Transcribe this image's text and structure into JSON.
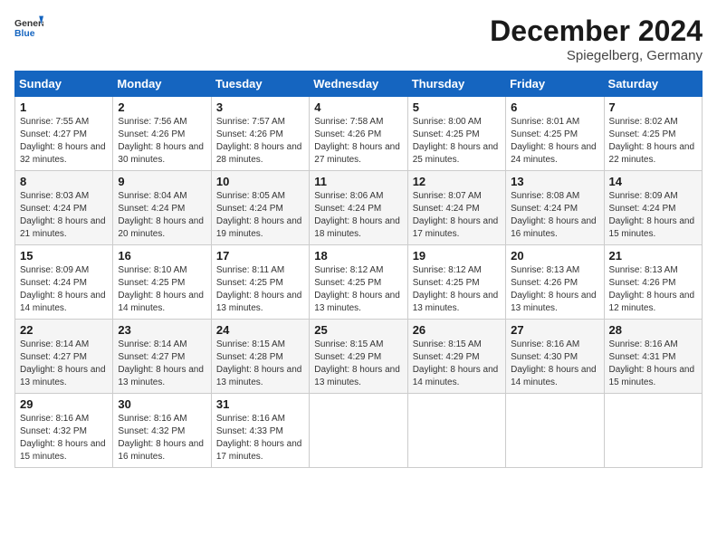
{
  "header": {
    "logo_line1": "General",
    "logo_line2": "Blue",
    "month": "December 2024",
    "location": "Spiegelberg, Germany"
  },
  "days_of_week": [
    "Sunday",
    "Monday",
    "Tuesday",
    "Wednesday",
    "Thursday",
    "Friday",
    "Saturday"
  ],
  "weeks": [
    [
      {
        "day": 1,
        "sunrise": "7:55 AM",
        "sunset": "4:27 PM",
        "daylight": "8 hours and 32 minutes."
      },
      {
        "day": 2,
        "sunrise": "7:56 AM",
        "sunset": "4:26 PM",
        "daylight": "8 hours and 30 minutes."
      },
      {
        "day": 3,
        "sunrise": "7:57 AM",
        "sunset": "4:26 PM",
        "daylight": "8 hours and 28 minutes."
      },
      {
        "day": 4,
        "sunrise": "7:58 AM",
        "sunset": "4:26 PM",
        "daylight": "8 hours and 27 minutes."
      },
      {
        "day": 5,
        "sunrise": "8:00 AM",
        "sunset": "4:25 PM",
        "daylight": "8 hours and 25 minutes."
      },
      {
        "day": 6,
        "sunrise": "8:01 AM",
        "sunset": "4:25 PM",
        "daylight": "8 hours and 24 minutes."
      },
      {
        "day": 7,
        "sunrise": "8:02 AM",
        "sunset": "4:25 PM",
        "daylight": "8 hours and 22 minutes."
      }
    ],
    [
      {
        "day": 8,
        "sunrise": "8:03 AM",
        "sunset": "4:24 PM",
        "daylight": "8 hours and 21 minutes."
      },
      {
        "day": 9,
        "sunrise": "8:04 AM",
        "sunset": "4:24 PM",
        "daylight": "8 hours and 20 minutes."
      },
      {
        "day": 10,
        "sunrise": "8:05 AM",
        "sunset": "4:24 PM",
        "daylight": "8 hours and 19 minutes."
      },
      {
        "day": 11,
        "sunrise": "8:06 AM",
        "sunset": "4:24 PM",
        "daylight": "8 hours and 18 minutes."
      },
      {
        "day": 12,
        "sunrise": "8:07 AM",
        "sunset": "4:24 PM",
        "daylight": "8 hours and 17 minutes."
      },
      {
        "day": 13,
        "sunrise": "8:08 AM",
        "sunset": "4:24 PM",
        "daylight": "8 hours and 16 minutes."
      },
      {
        "day": 14,
        "sunrise": "8:09 AM",
        "sunset": "4:24 PM",
        "daylight": "8 hours and 15 minutes."
      }
    ],
    [
      {
        "day": 15,
        "sunrise": "8:09 AM",
        "sunset": "4:24 PM",
        "daylight": "8 hours and 14 minutes."
      },
      {
        "day": 16,
        "sunrise": "8:10 AM",
        "sunset": "4:25 PM",
        "daylight": "8 hours and 14 minutes."
      },
      {
        "day": 17,
        "sunrise": "8:11 AM",
        "sunset": "4:25 PM",
        "daylight": "8 hours and 13 minutes."
      },
      {
        "day": 18,
        "sunrise": "8:12 AM",
        "sunset": "4:25 PM",
        "daylight": "8 hours and 13 minutes."
      },
      {
        "day": 19,
        "sunrise": "8:12 AM",
        "sunset": "4:25 PM",
        "daylight": "8 hours and 13 minutes."
      },
      {
        "day": 20,
        "sunrise": "8:13 AM",
        "sunset": "4:26 PM",
        "daylight": "8 hours and 13 minutes."
      },
      {
        "day": 21,
        "sunrise": "8:13 AM",
        "sunset": "4:26 PM",
        "daylight": "8 hours and 12 minutes."
      }
    ],
    [
      {
        "day": 22,
        "sunrise": "8:14 AM",
        "sunset": "4:27 PM",
        "daylight": "8 hours and 13 minutes."
      },
      {
        "day": 23,
        "sunrise": "8:14 AM",
        "sunset": "4:27 PM",
        "daylight": "8 hours and 13 minutes."
      },
      {
        "day": 24,
        "sunrise": "8:15 AM",
        "sunset": "4:28 PM",
        "daylight": "8 hours and 13 minutes."
      },
      {
        "day": 25,
        "sunrise": "8:15 AM",
        "sunset": "4:29 PM",
        "daylight": "8 hours and 13 minutes."
      },
      {
        "day": 26,
        "sunrise": "8:15 AM",
        "sunset": "4:29 PM",
        "daylight": "8 hours and 14 minutes."
      },
      {
        "day": 27,
        "sunrise": "8:16 AM",
        "sunset": "4:30 PM",
        "daylight": "8 hours and 14 minutes."
      },
      {
        "day": 28,
        "sunrise": "8:16 AM",
        "sunset": "4:31 PM",
        "daylight": "8 hours and 15 minutes."
      }
    ],
    [
      {
        "day": 29,
        "sunrise": "8:16 AM",
        "sunset": "4:32 PM",
        "daylight": "8 hours and 15 minutes."
      },
      {
        "day": 30,
        "sunrise": "8:16 AM",
        "sunset": "4:32 PM",
        "daylight": "8 hours and 16 minutes."
      },
      {
        "day": 31,
        "sunrise": "8:16 AM",
        "sunset": "4:33 PM",
        "daylight": "8 hours and 17 minutes."
      },
      null,
      null,
      null,
      null
    ]
  ]
}
